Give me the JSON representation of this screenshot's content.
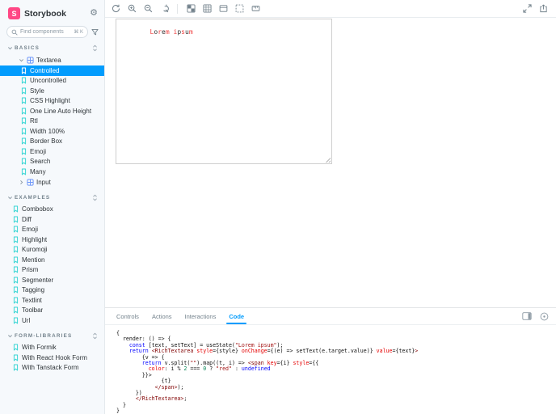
{
  "colors": {
    "accent": "#029CFD",
    "brand": "#FF4785",
    "story_icon": "#37D5D3",
    "component_icon": "#6F98F9",
    "alt_char_color": "red"
  },
  "sidebar": {
    "brand": {
      "name": "Storybook",
      "logo_letter": "S"
    },
    "search": {
      "placeholder": "Find components",
      "shortcut": "⌘ K"
    },
    "sections": [
      {
        "label": "BASICS",
        "items": [
          {
            "type": "component",
            "label": "Textarea",
            "expanded": true,
            "children": [
              {
                "label": "Controlled",
                "selected": true
              },
              {
                "label": "Uncontrolled"
              },
              {
                "label": "Style"
              },
              {
                "label": "CSS Highlight"
              },
              {
                "label": "One Line Auto Height"
              },
              {
                "label": "Rtl"
              },
              {
                "label": "Width 100%"
              },
              {
                "label": "Border Box"
              },
              {
                "label": "Emoji"
              },
              {
                "label": "Search"
              },
              {
                "label": "Many"
              }
            ]
          },
          {
            "type": "component",
            "label": "Input",
            "expanded": false,
            "children": []
          }
        ]
      },
      {
        "label": "EXAMPLES",
        "items": [
          {
            "type": "story",
            "label": "Combobox"
          },
          {
            "type": "story",
            "label": "Diff"
          },
          {
            "type": "story",
            "label": "Emoji"
          },
          {
            "type": "story",
            "label": "Highlight"
          },
          {
            "type": "story",
            "label": "Kuromoji"
          },
          {
            "type": "story",
            "label": "Mention"
          },
          {
            "type": "story",
            "label": "Prism"
          },
          {
            "type": "story",
            "label": "Segmenter"
          },
          {
            "type": "story",
            "label": "Tagging"
          },
          {
            "type": "story",
            "label": "Textlint"
          },
          {
            "type": "story",
            "label": "Toolbar"
          },
          {
            "type": "story",
            "label": "Url"
          }
        ]
      },
      {
        "label": "FORM-LIBRARIES",
        "items": [
          {
            "type": "story",
            "label": "With Formik"
          },
          {
            "type": "story",
            "label": "With React Hook Form"
          },
          {
            "type": "story",
            "label": "With Tanstack Form"
          }
        ]
      }
    ]
  },
  "toolbar": {
    "left_icons": [
      "remount",
      "zoom-in",
      "zoom-out",
      "zoom-reset",
      "divider",
      "background",
      "grid",
      "viewport",
      "outline",
      "measure"
    ],
    "right_icons": [
      "fullscreen",
      "open-external"
    ]
  },
  "canvas": {
    "textarea_value": "Lorem ipsum"
  },
  "panel": {
    "tabs": [
      {
        "label": "Controls",
        "active": false
      },
      {
        "label": "Actions",
        "active": false
      },
      {
        "label": "Interactions",
        "active": false
      },
      {
        "label": "Code",
        "active": true
      }
    ],
    "right_icons": [
      "panel-position",
      "collapse-panel"
    ],
    "code_lines": [
      [
        {
          "c": "p",
          "t": "{"
        }
      ],
      [
        {
          "c": "p",
          "t": "  render: () => {"
        }
      ],
      [
        {
          "c": "p",
          "t": "    "
        },
        {
          "c": "k",
          "t": "const"
        },
        {
          "c": "p",
          "t": " [text, setText] = useState("
        },
        {
          "c": "s",
          "t": "\"Lorem ipsum\""
        },
        {
          "c": "p",
          "t": ");"
        }
      ],
      [
        {
          "c": "p",
          "t": "    "
        },
        {
          "c": "k",
          "t": "return"
        },
        {
          "c": "p",
          "t": " "
        },
        {
          "c": "t",
          "t": "<RichTextarea"
        },
        {
          "c": "p",
          "t": " "
        },
        {
          "c": "a",
          "t": "style"
        },
        {
          "c": "p",
          "t": "={style} "
        },
        {
          "c": "a",
          "t": "onChange"
        },
        {
          "c": "p",
          "t": "={(e) => setText(e.target.value)} "
        },
        {
          "c": "a",
          "t": "value"
        },
        {
          "c": "p",
          "t": "={text}"
        },
        {
          "c": "t",
          "t": ">"
        }
      ],
      [
        {
          "c": "p",
          "t": "        {v => {"
        }
      ],
      [
        {
          "c": "p",
          "t": "        "
        },
        {
          "c": "k",
          "t": "return"
        },
        {
          "c": "p",
          "t": " v.split("
        },
        {
          "c": "s",
          "t": "\"\""
        },
        {
          "c": "p",
          "t": ").map((t, i) => "
        },
        {
          "c": "t",
          "t": "<span"
        },
        {
          "c": "p",
          "t": " "
        },
        {
          "c": "a",
          "t": "key"
        },
        {
          "c": "p",
          "t": "={i} "
        },
        {
          "c": "a",
          "t": "style"
        },
        {
          "c": "p",
          "t": "={{"
        }
      ],
      [
        {
          "c": "p",
          "t": "          "
        },
        {
          "c": "a",
          "t": "color"
        },
        {
          "c": "p",
          "t": ": i % "
        },
        {
          "c": "n",
          "t": "2"
        },
        {
          "c": "p",
          "t": " === "
        },
        {
          "c": "n",
          "t": "0"
        },
        {
          "c": "p",
          "t": " ? "
        },
        {
          "c": "s",
          "t": "\"red\""
        },
        {
          "c": "p",
          "t": " : "
        },
        {
          "c": "k",
          "t": "undefined"
        }
      ],
      [
        {
          "c": "p",
          "t": "        }}>"
        }
      ],
      [
        {
          "c": "p",
          "t": "              {t}"
        }
      ],
      [
        {
          "c": "p",
          "t": "            "
        },
        {
          "c": "t",
          "t": "</span>"
        },
        {
          "c": "p",
          "t": ");"
        }
      ],
      [
        {
          "c": "p",
          "t": "      })"
        }
      ],
      [
        {
          "c": "p",
          "t": "      "
        },
        {
          "c": "t",
          "t": "</RichTextarea>"
        },
        {
          "c": "p",
          "t": ";"
        }
      ],
      [
        {
          "c": "p",
          "t": "  }"
        }
      ],
      [
        {
          "c": "p",
          "t": "}"
        }
      ]
    ]
  }
}
